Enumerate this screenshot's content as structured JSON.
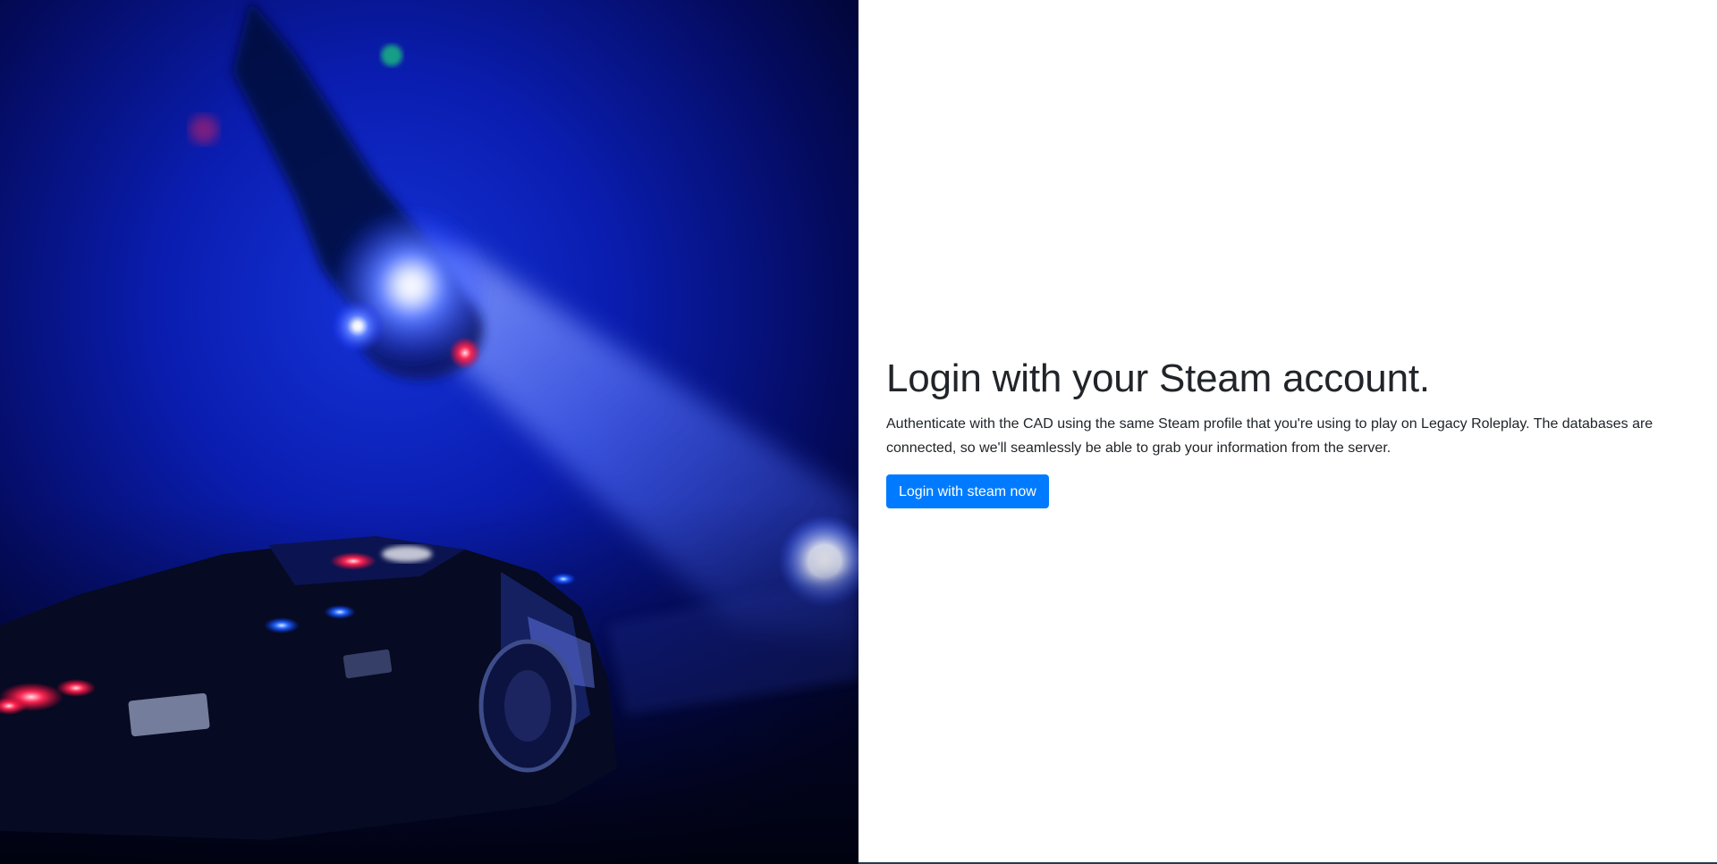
{
  "hero": {
    "image_label": "Police car under helicopter spotlight at night"
  },
  "login": {
    "heading": "Login with your Steam account.",
    "description": "Authenticate with the CAD using the same Steam profile that you're using to play on Legacy Roleplay. The databases are connected, so we'll seamlessly be able to grab your information from the server.",
    "button_label": "Login with steam now"
  },
  "colors": {
    "primary": "#007bff",
    "text": "#212529",
    "background": "#ffffff"
  }
}
